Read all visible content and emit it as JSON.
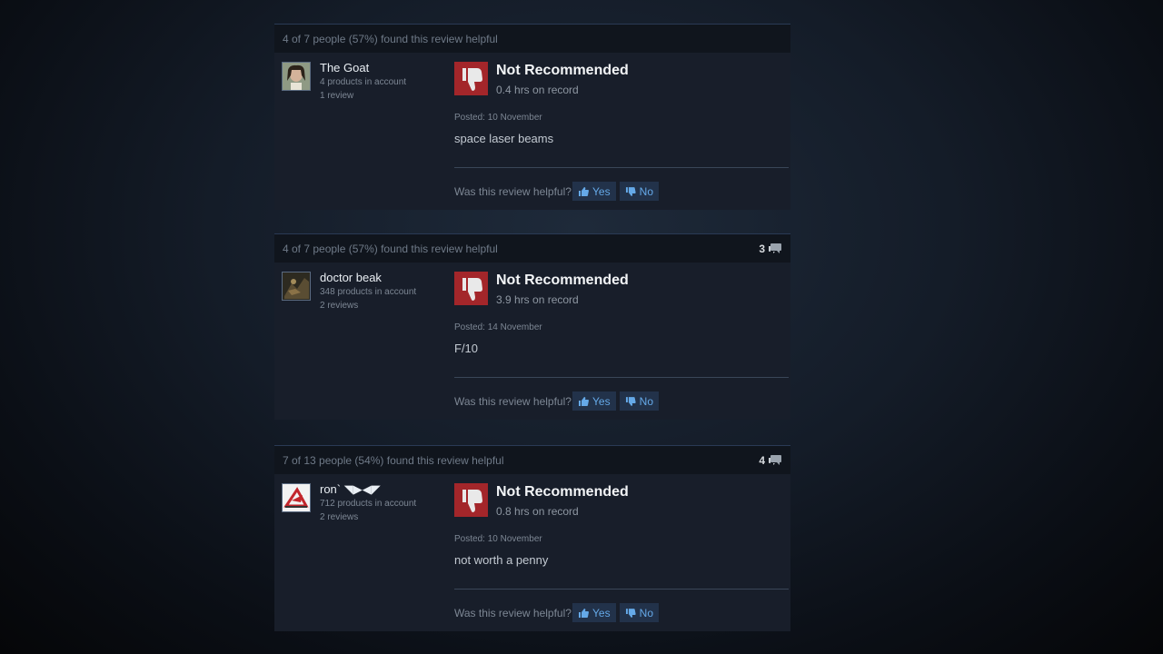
{
  "reviews": [
    {
      "helpful_summary": "4 of 7 people (57%) found this review helpful",
      "comment_count": "",
      "author": {
        "name": "The Goat",
        "products": "4 products in account",
        "reviews": "1 review"
      },
      "verdict": "Not Recommended",
      "hours": "0.4 hrs on record",
      "posted": "Posted: 10 November",
      "text": "space laser beams",
      "helpful_question": "Was this review helpful?",
      "yes_label": "Yes",
      "no_label": "No"
    },
    {
      "helpful_summary": "4 of 7 people (57%) found this review helpful",
      "comment_count": "3",
      "author": {
        "name": "doctor beak",
        "products": "348 products in account",
        "reviews": "2 reviews"
      },
      "verdict": "Not Recommended",
      "hours": "3.9 hrs on record",
      "posted": "Posted: 14 November",
      "text": "F/10",
      "helpful_question": "Was this review helpful?",
      "yes_label": "Yes",
      "no_label": "No"
    },
    {
      "helpful_summary": "7 of 13 people (54%) found this review helpful",
      "comment_count": "4",
      "author": {
        "name": "ron` ◥▶◀◤",
        "products": "712 products in account",
        "reviews": "2 reviews"
      },
      "verdict": "Not Recommended",
      "hours": "0.8 hrs on record",
      "posted": "Posted: 10 November",
      "text": "not worth a penny",
      "helpful_question": "Was this review helpful?",
      "yes_label": "Yes",
      "no_label": "No"
    }
  ],
  "colors": {
    "thumb_down_red": "#a3262a",
    "vote_blue": "#65a9e8",
    "card_bg": "#181e2a"
  }
}
